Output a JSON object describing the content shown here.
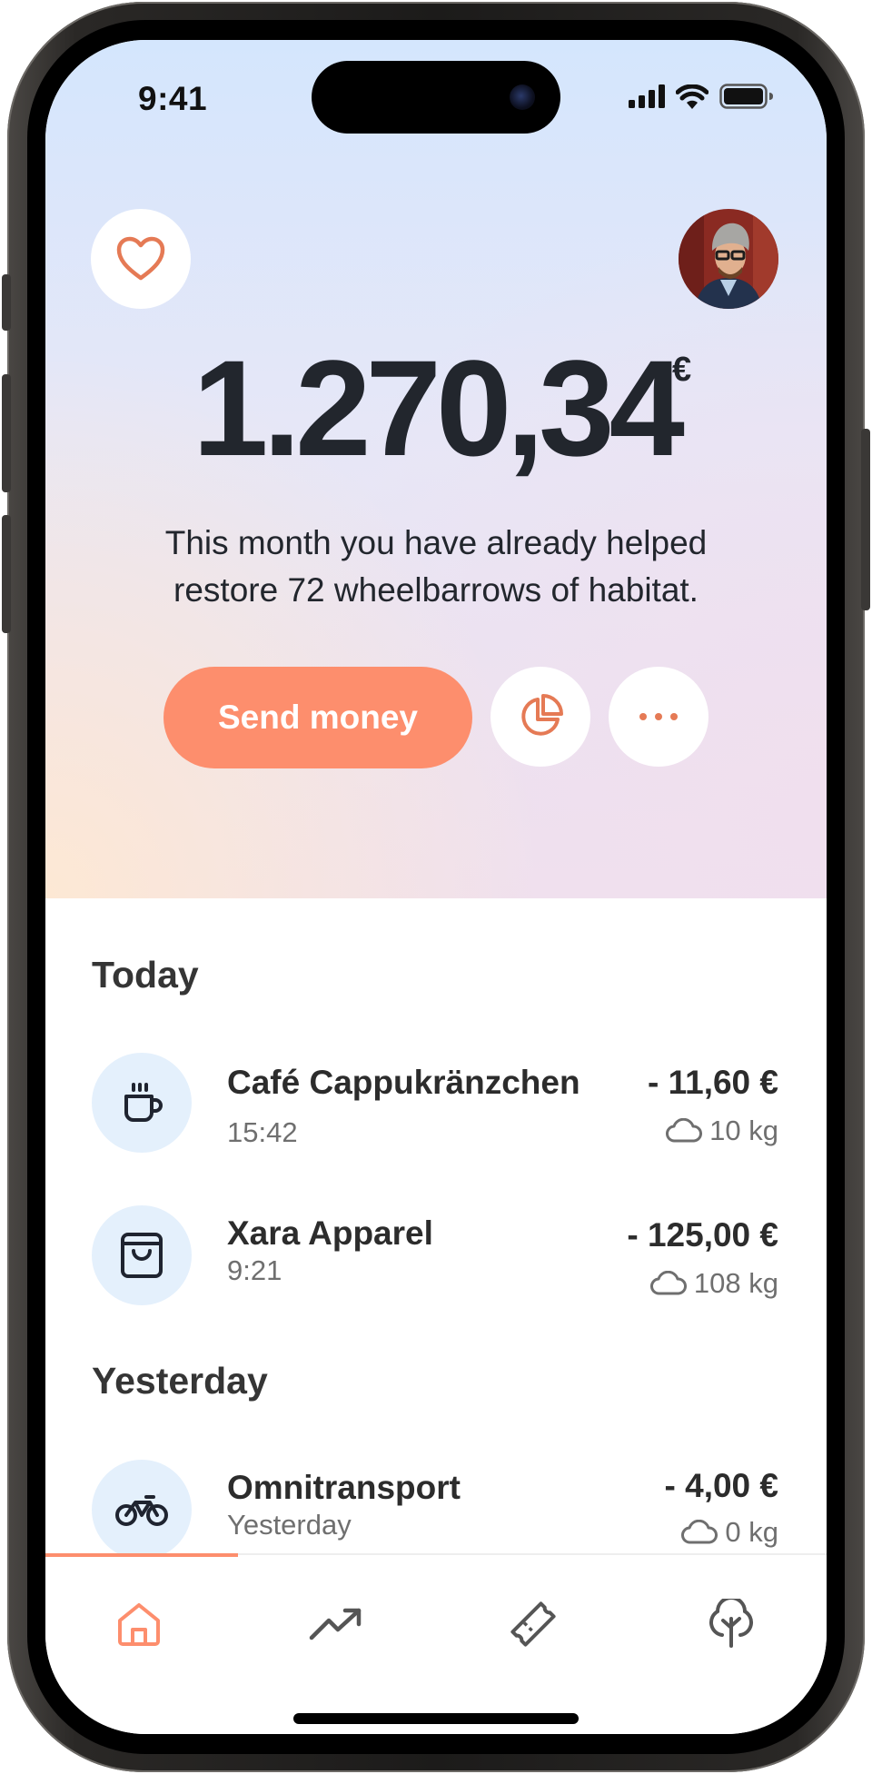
{
  "status_bar": {
    "time": "9:41"
  },
  "balance": {
    "amount": "1.270,34",
    "currency": "€"
  },
  "impact_message": {
    "line1": "This month you have already helped",
    "line2": "restore 72 wheelbarrows of habitat."
  },
  "actions": {
    "send_label": "Send money",
    "stats_icon": "pie-chart-icon",
    "more_icon": "more-dots-icon"
  },
  "icons": {
    "favorite": "heart-icon",
    "profile": "avatar"
  },
  "sections": [
    {
      "title": "Today",
      "transactions": [
        {
          "name": "Café Cappukränzchen",
          "time": "15:42",
          "amount": "- 11,60 €",
          "co2": "10 kg",
          "icon": "coffee-cup-icon"
        },
        {
          "name": "Xara Apparel",
          "time": "9:21",
          "amount": "- 125,00 €",
          "co2": "108 kg",
          "icon": "shopping-bag-icon"
        }
      ]
    },
    {
      "title": "Yesterday",
      "transactions": [
        {
          "name": "Omnitransport",
          "time": "Yesterday",
          "amount": "- 4,00 €",
          "co2": "0 kg",
          "icon": "bicycle-icon"
        }
      ]
    }
  ],
  "tab_bar": {
    "active": "home",
    "tabs": [
      {
        "id": "home",
        "icon": "home-icon"
      },
      {
        "id": "trends",
        "icon": "trend-chart-icon"
      },
      {
        "id": "vouchers",
        "icon": "ticket-icon"
      },
      {
        "id": "impact",
        "icon": "tree-icon"
      }
    ]
  },
  "colors": {
    "accent": "#fd8e6d",
    "icon_bubble": "#e4f0fc",
    "text_primary": "#22262d",
    "text_secondary": "#6f6f6f"
  }
}
